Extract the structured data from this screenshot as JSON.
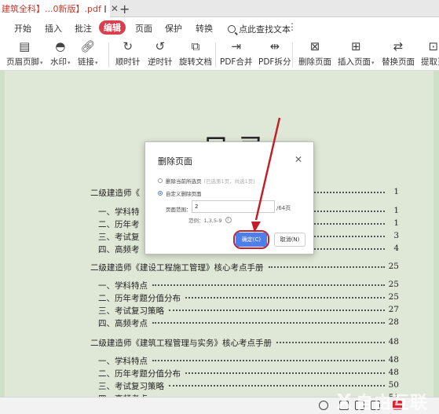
{
  "tab": {
    "title": "建筑全科】...0新版】.pdf"
  },
  "menu": {
    "items": [
      "开始",
      "插入",
      "批注",
      "编辑",
      "页面",
      "保护",
      "转换"
    ],
    "active": "编辑",
    "search_label": "点此查找文本"
  },
  "toolbar": {
    "header_footer": "页眉页脚",
    "watermark": "水印",
    "link": "链接",
    "rotate_cw": "顺时针",
    "rotate_ccw": "逆时针",
    "rotate_doc": "旋转文档",
    "pdf_merge": "PDF合并",
    "pdf_split": "PDF拆分",
    "delete_page": "删除页面",
    "insert_page": "插入页面",
    "replace_page": "替换页面",
    "extract_page": "提取页"
  },
  "document": {
    "title": "目  录",
    "toc": [
      {
        "text": "二级建造师《",
        "page": "1",
        "level": 0
      },
      {
        "text": "一、学科特",
        "page": "1",
        "level": 1
      },
      {
        "text": "二、历年考",
        "page": "1",
        "level": 1
      },
      {
        "text": "三、考试复",
        "page": "3",
        "level": 1
      },
      {
        "text": "四、高频考",
        "page": "4",
        "level": 1
      },
      {
        "text": "二级建造师《建设工程施工管理》核心考点手册",
        "page": "25",
        "level": 0
      },
      {
        "text": "一、学科特点",
        "page": "25",
        "level": 1
      },
      {
        "text": "二、历年考题分值分布",
        "page": "25",
        "level": 1
      },
      {
        "text": "三、考试复习策略",
        "page": "27",
        "level": 1
      },
      {
        "text": "四、高频考点",
        "page": "28",
        "level": 1
      },
      {
        "text": "二级建造师《建筑工程管理与实务》核心考点手册",
        "page": "48",
        "level": 0
      },
      {
        "text": "一、学科特点",
        "page": "48",
        "level": 1
      },
      {
        "text": "二、历年考题分值分布",
        "page": "48",
        "level": 1
      },
      {
        "text": "三、考试复习策略",
        "page": "50",
        "level": 1
      },
      {
        "text": "四、高频考点",
        "page": "51",
        "level": 1
      }
    ]
  },
  "dialog": {
    "title": "删除页面",
    "option_current": "删除当前所选页",
    "option_current_hint": "(已选第1页，共选1页)",
    "option_custom": "自定义删除页面",
    "range_label": "页面范围：",
    "range_value": "2",
    "range_total": "/64页",
    "example": "范例：1,3,5-9",
    "ok_label": "确定(C)",
    "cancel_label": "取消(N)"
  },
  "watermark": {
    "mark": "X",
    "text": "自由互联"
  },
  "colors": {
    "accent": "#d9404f",
    "primary_button": "#4f7fe6",
    "page_bg": "#dfe8d6",
    "highlight_ring": "#c0202a"
  }
}
